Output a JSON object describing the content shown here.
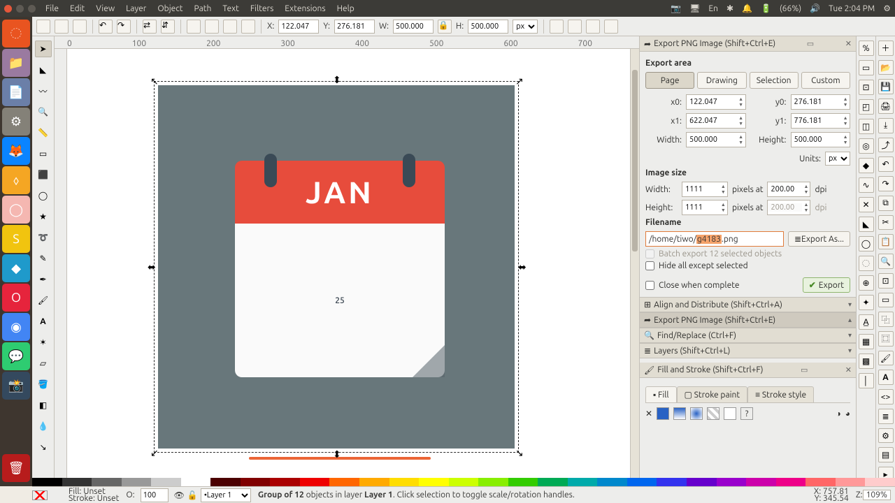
{
  "menubar": [
    "File",
    "Edit",
    "View",
    "Layer",
    "Object",
    "Path",
    "Text",
    "Filters",
    "Extensions",
    "Help"
  ],
  "systray": {
    "lang": "En",
    "battery": "(66%)",
    "clock": "Tue  2:04 PM"
  },
  "toolbar": {
    "X_lbl": "X:",
    "X": "122.047",
    "Y_lbl": "Y:",
    "Y": "276.181",
    "W_lbl": "W:",
    "W": "500.000",
    "H_lbl": "H:",
    "H": "500.000",
    "units": "px"
  },
  "ruler_ticks": [
    "0",
    "100",
    "200",
    "300",
    "400",
    "500",
    "600",
    "700"
  ],
  "artwork": {
    "month": "JAN",
    "day": "25"
  },
  "export": {
    "title": "Export PNG Image (Shift+Ctrl+E)",
    "area_lbl": "Export area",
    "tabs": [
      "Page",
      "Drawing",
      "Selection",
      "Custom"
    ],
    "x0_lbl": "x0:",
    "x0": "122.047",
    "y0_lbl": "y0:",
    "y0": "276.181",
    "x1_lbl": "x1:",
    "x1": "622.047",
    "y1_lbl": "y1:",
    "y1": "776.181",
    "w_lbl": "Width:",
    "w": "500.000",
    "h_lbl": "Height:",
    "h": "500.000",
    "units_lbl": "Units:",
    "units": "px",
    "imgsize_lbl": "Image size",
    "iw": "1111",
    "ih": "1111",
    "px_at": "pixels at",
    "dpi_w": "200.00",
    "dpi_h": "200.00",
    "dpi_lbl": "dpi",
    "fn_lbl": "Filename",
    "fn_pre": "/home/tiwo/",
    "fn_sel": "g4183",
    "fn_post": ".png",
    "exportas": "Export As...",
    "batch": "Batch export 12 selected objects",
    "hide": "Hide all except selected",
    "close": "Close when complete",
    "export_btn": "Export"
  },
  "collapsed_panels": [
    "Align and Distribute (Shift+Ctrl+A)",
    "Export PNG Image (Shift+Ctrl+E)",
    "Find/Replace (Ctrl+F)",
    "Layers (Shift+Ctrl+L)"
  ],
  "fillstroke": {
    "title": "Fill and Stroke (Shift+Ctrl+F)",
    "tabs": [
      "Fill",
      "Stroke paint",
      "Stroke style"
    ]
  },
  "status": {
    "fill_lbl": "Fill:",
    "stroke_lbl": "Stroke:",
    "unset": "Unset",
    "o_lbl": "O:",
    "opacity": "100",
    "layer": "Layer 1",
    "msg_pre": "Group",
    "msg_bold": " of 12 ",
    "msg_mid": "objects in layer ",
    "msg_layer": "Layer 1",
    "msg_post": ". Click selection to toggle scale/rotation handles.",
    "xcoord": "X:   757.81",
    "ycoord": "Y:   345.54",
    "zlabel": "Z:",
    "zoom": "109%"
  },
  "palette_colors": [
    "#000",
    "#333",
    "#666",
    "#999",
    "#ccc",
    "#fff",
    "#4b0000",
    "#800000",
    "#a00",
    "#e00",
    "#f60",
    "#fa0",
    "#fd0",
    "#ff0",
    "#cf0",
    "#8e0",
    "#3c0",
    "#0a5",
    "#0aa",
    "#08c",
    "#06e",
    "#33e",
    "#60c",
    "#90c",
    "#c0a",
    "#e08",
    "#f66",
    "#f99",
    "#fcc"
  ]
}
